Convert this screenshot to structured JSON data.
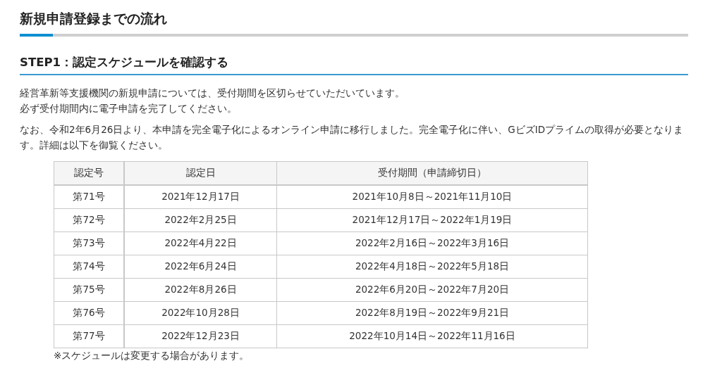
{
  "page_title": "新規申請登録までの流れ",
  "step_heading": "STEP1：認定スケジュールを確認する",
  "paragraphs": [
    [
      "経営革新等支援機関の新規申請については、受付期間を区切らせていただいています。",
      "必ず受付期間内に電子申請を完了してください。"
    ],
    [
      "なお、令和2年6月26日より、本申請を完全電子化によるオンライン申請に移行しました。完全電子化に伴い、GビズIDプライムの取得が必要となります。詳細は以下を御覧ください。"
    ]
  ],
  "table": {
    "columns": [
      "認定号",
      "認定日",
      "受付期間（申請締切日）"
    ],
    "rows": [
      [
        "第71号",
        "2021年12月17日",
        "2021年10月8日～2021年11月10日"
      ],
      [
        "第72号",
        "2022年2月25日",
        "2021年12月17日～2022年1月19日"
      ],
      [
        "第73号",
        "2022年4月22日",
        "2022年2月16日～2022年3月16日"
      ],
      [
        "第74号",
        "2022年6月24日",
        "2022年4月18日～2022年5月18日"
      ],
      [
        "第75号",
        "2022年8月26日",
        "2022年6月20日～2022年7月20日"
      ],
      [
        "第76号",
        "2022年10月28日",
        "2022年8月19日～2022年9月21日"
      ],
      [
        "第77号",
        "2022年12月23日",
        "2022年10月14日～2022年11月16日"
      ]
    ]
  },
  "note": "※スケジュールは変更する場合があります。"
}
